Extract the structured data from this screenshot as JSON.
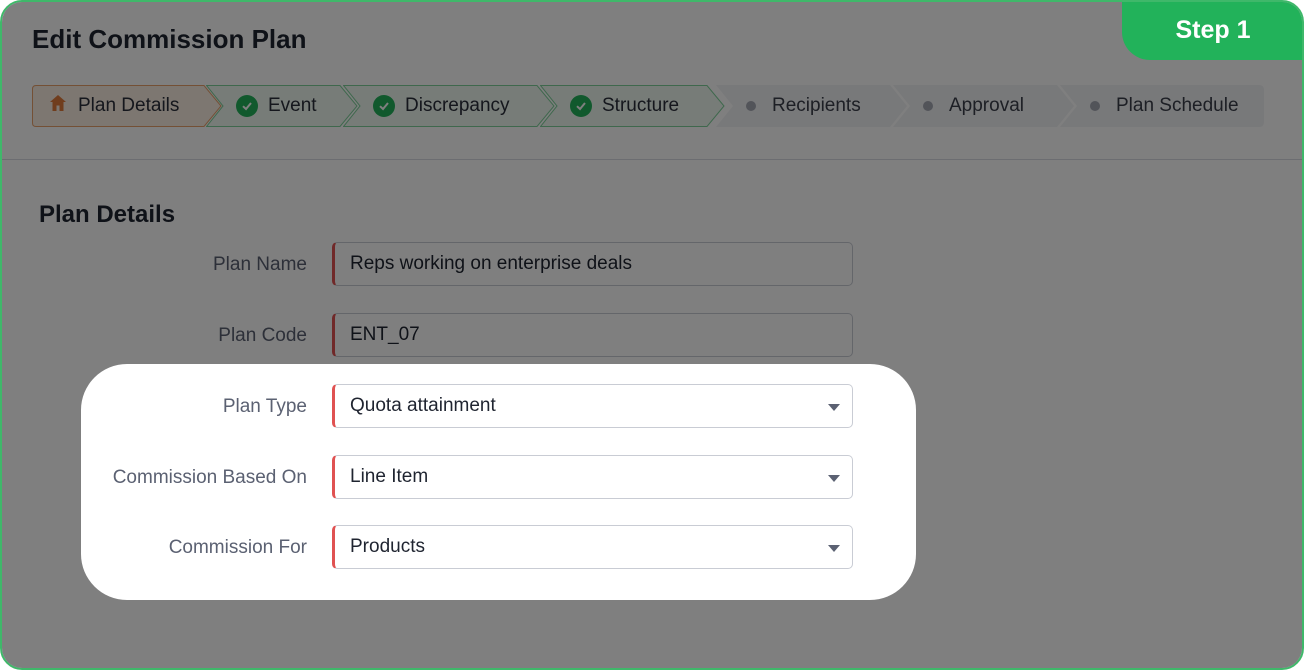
{
  "header": {
    "title": "Edit Commission Plan",
    "step_badge": "Step 1"
  },
  "stepper": {
    "steps": [
      {
        "label": "Plan Details",
        "state": "current",
        "icon": "home-icon"
      },
      {
        "label": "Event",
        "state": "done",
        "icon": "check-icon"
      },
      {
        "label": "Discrepancy",
        "state": "done",
        "icon": "check-icon"
      },
      {
        "label": "Structure",
        "state": "done",
        "icon": "check-icon"
      },
      {
        "label": "Recipients",
        "state": "pending",
        "icon": "dot-icon"
      },
      {
        "label": "Approval",
        "state": "pending",
        "icon": "dot-icon"
      },
      {
        "label": "Plan Schedule",
        "state": "pending",
        "icon": "dot-icon"
      }
    ]
  },
  "form": {
    "section_title": "Plan Details",
    "fields": [
      {
        "label": "Plan Name",
        "value": "Reps working on enterprise deals",
        "type": "text"
      },
      {
        "label": "Plan Code",
        "value": "ENT_07",
        "type": "text"
      },
      {
        "label": "Plan Type",
        "value": "Quota attainment",
        "type": "select"
      },
      {
        "label": "Commission Based On",
        "value": "Line Item",
        "type": "select"
      },
      {
        "label": "Commission For",
        "value": "Products",
        "type": "select"
      }
    ]
  },
  "colors": {
    "accent_green": "#22b25a",
    "current_step_orange": "#e07b3a",
    "required_red": "#e05252",
    "overlay_dim": "rgba(0,0,0,0.5)"
  }
}
